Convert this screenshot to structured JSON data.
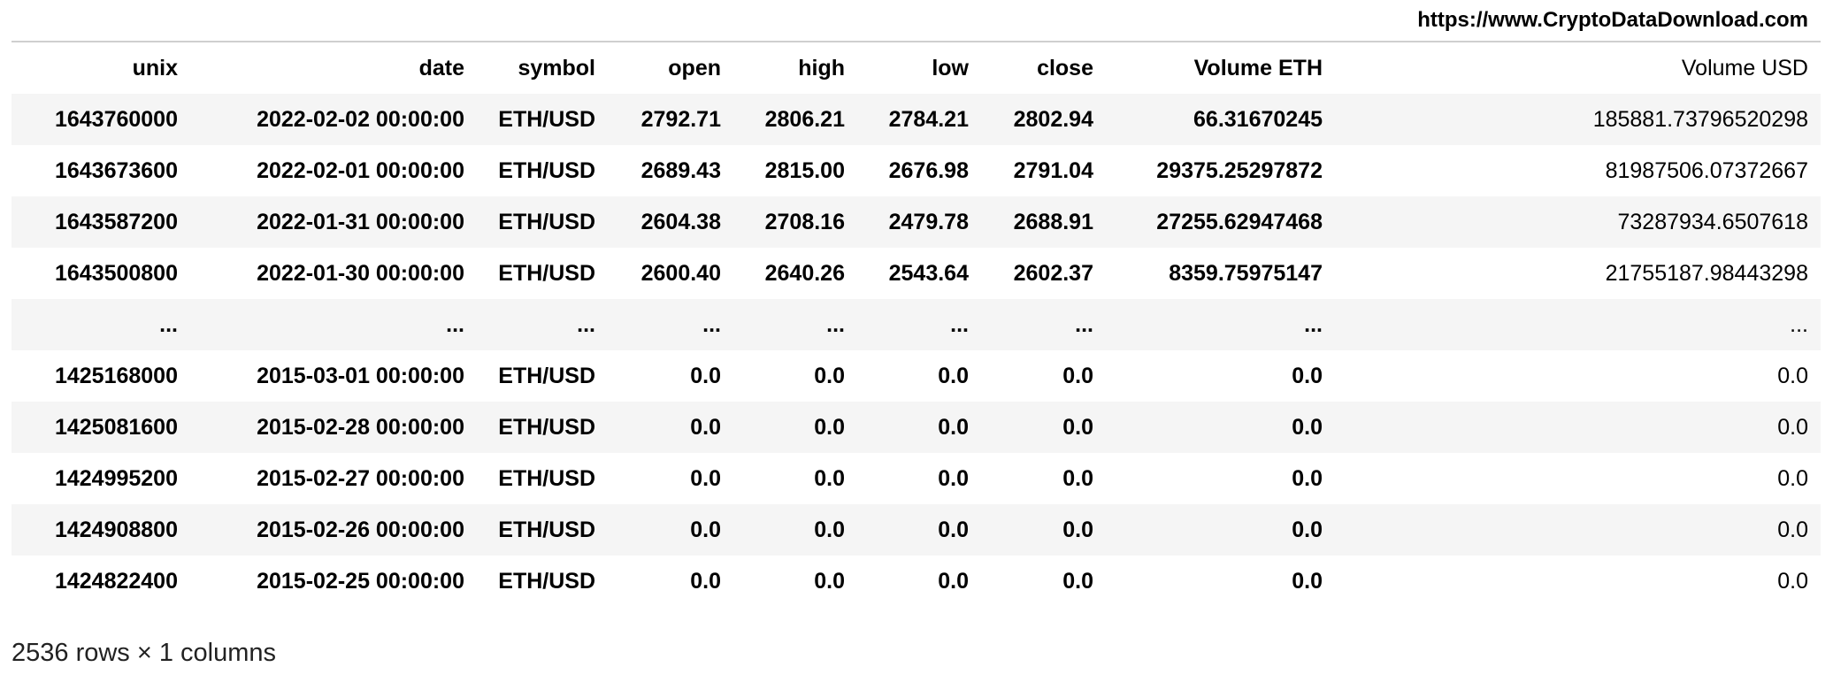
{
  "source_url": "https://www.CryptoDataDownload.com",
  "columns": [
    "unix",
    "date",
    "symbol",
    "open",
    "high",
    "low",
    "close",
    "Volume ETH",
    "Volume USD"
  ],
  "rows": [
    [
      "1643760000",
      "2022-02-02 00:00:00",
      "ETH/USD",
      "2792.71",
      "2806.21",
      "2784.21",
      "2802.94",
      "66.31670245",
      "185881.73796520298"
    ],
    [
      "1643673600",
      "2022-02-01 00:00:00",
      "ETH/USD",
      "2689.43",
      "2815.00",
      "2676.98",
      "2791.04",
      "29375.25297872",
      "81987506.07372667"
    ],
    [
      "1643587200",
      "2022-01-31 00:00:00",
      "ETH/USD",
      "2604.38",
      "2708.16",
      "2479.78",
      "2688.91",
      "27255.62947468",
      "73287934.6507618"
    ],
    [
      "1643500800",
      "2022-01-30 00:00:00",
      "ETH/USD",
      "2600.40",
      "2640.26",
      "2543.64",
      "2602.37",
      "8359.75975147",
      "21755187.98443298"
    ],
    [
      "...",
      "...",
      "...",
      "...",
      "...",
      "...",
      "...",
      "...",
      "..."
    ],
    [
      "1425168000",
      "2015-03-01 00:00:00",
      "ETH/USD",
      "0.0",
      "0.0",
      "0.0",
      "0.0",
      "0.0",
      "0.0"
    ],
    [
      "1425081600",
      "2015-02-28 00:00:00",
      "ETH/USD",
      "0.0",
      "0.0",
      "0.0",
      "0.0",
      "0.0",
      "0.0"
    ],
    [
      "1424995200",
      "2015-02-27 00:00:00",
      "ETH/USD",
      "0.0",
      "0.0",
      "0.0",
      "0.0",
      "0.0",
      "0.0"
    ],
    [
      "1424908800",
      "2015-02-26 00:00:00",
      "ETH/USD",
      "0.0",
      "0.0",
      "0.0",
      "0.0",
      "0.0",
      "0.0"
    ],
    [
      "1424822400",
      "2015-02-25 00:00:00",
      "ETH/USD",
      "0.0",
      "0.0",
      "0.0",
      "0.0",
      "0.0",
      "0.0"
    ]
  ],
  "footer": "2536 rows × 1 columns"
}
